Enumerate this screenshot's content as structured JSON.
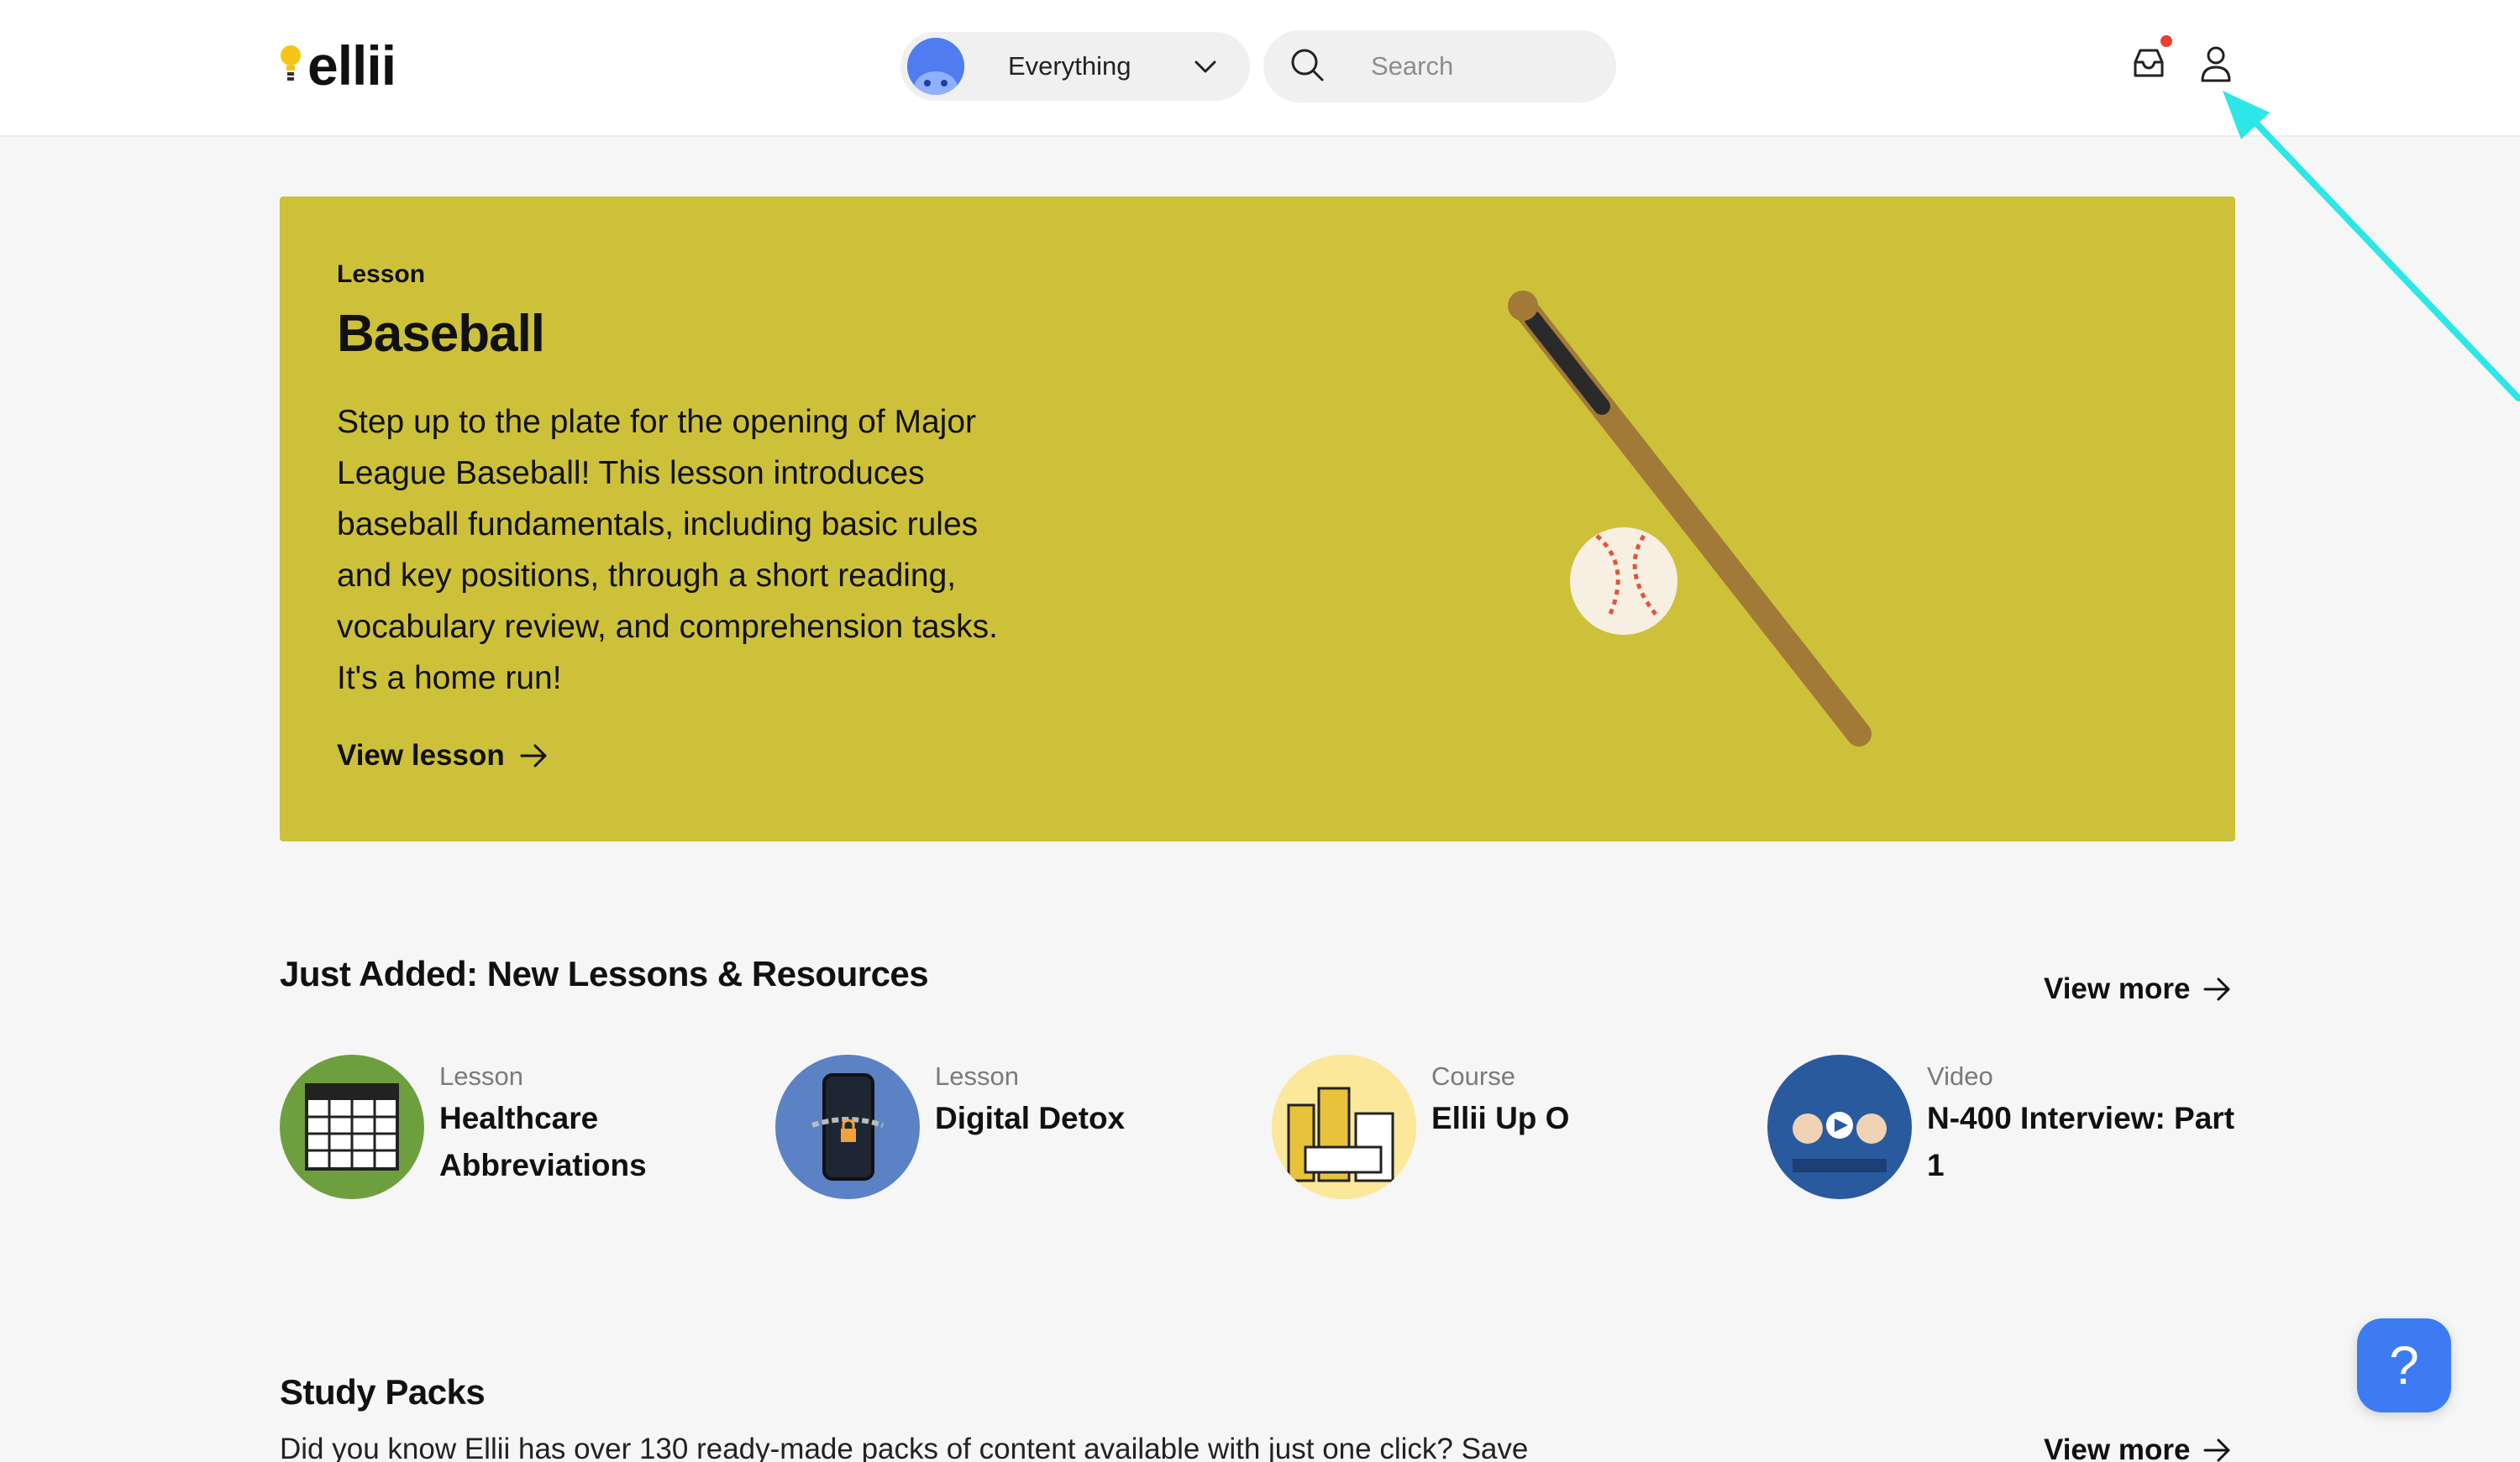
{
  "header": {
    "logo_text": "ellii",
    "scope": {
      "label": "Everything",
      "icon": "chevron-down-icon"
    },
    "search": {
      "placeholder": "Search",
      "value": ""
    },
    "icons": [
      "inbox-icon",
      "user-icon"
    ],
    "notification_color": "#e8402f"
  },
  "hero": {
    "type": "Lesson",
    "title": "Baseball",
    "description": "Step up to the plate for the opening of Major League Baseball! This lesson introduces baseball fundamentals, including basic rules and key positions, through a short reading, vocabulary review, and comprehension tasks. It's a home run!",
    "link_label": "View lesson",
    "background_color": "#cdc13a"
  },
  "just_added": {
    "title": "Just Added: New Lessons & Resources",
    "view_more": "View more",
    "items": [
      {
        "type": "Lesson",
        "title": "Healthcare Abbreviations",
        "thumb_color": "#6e9f3f"
      },
      {
        "type": "Lesson",
        "title": "Digital Detox",
        "thumb_color": "#5b82c4"
      },
      {
        "type": "Course",
        "title": "Ellii Up O",
        "thumb_color": "#f3d64e"
      },
      {
        "type": "Video",
        "title": "N-400 Interview: Part 1",
        "thumb_color": "#2a5a9e"
      }
    ]
  },
  "study_packs": {
    "title": "Study Packs",
    "description": "Did you know Ellii has over 130 ready-made packs of content available with just one click? Save",
    "view_more": "View more"
  },
  "help_button": {
    "label": "?",
    "color": "#3d7bf2"
  },
  "annotation": {
    "arrow_color": "#2ee6e6"
  }
}
